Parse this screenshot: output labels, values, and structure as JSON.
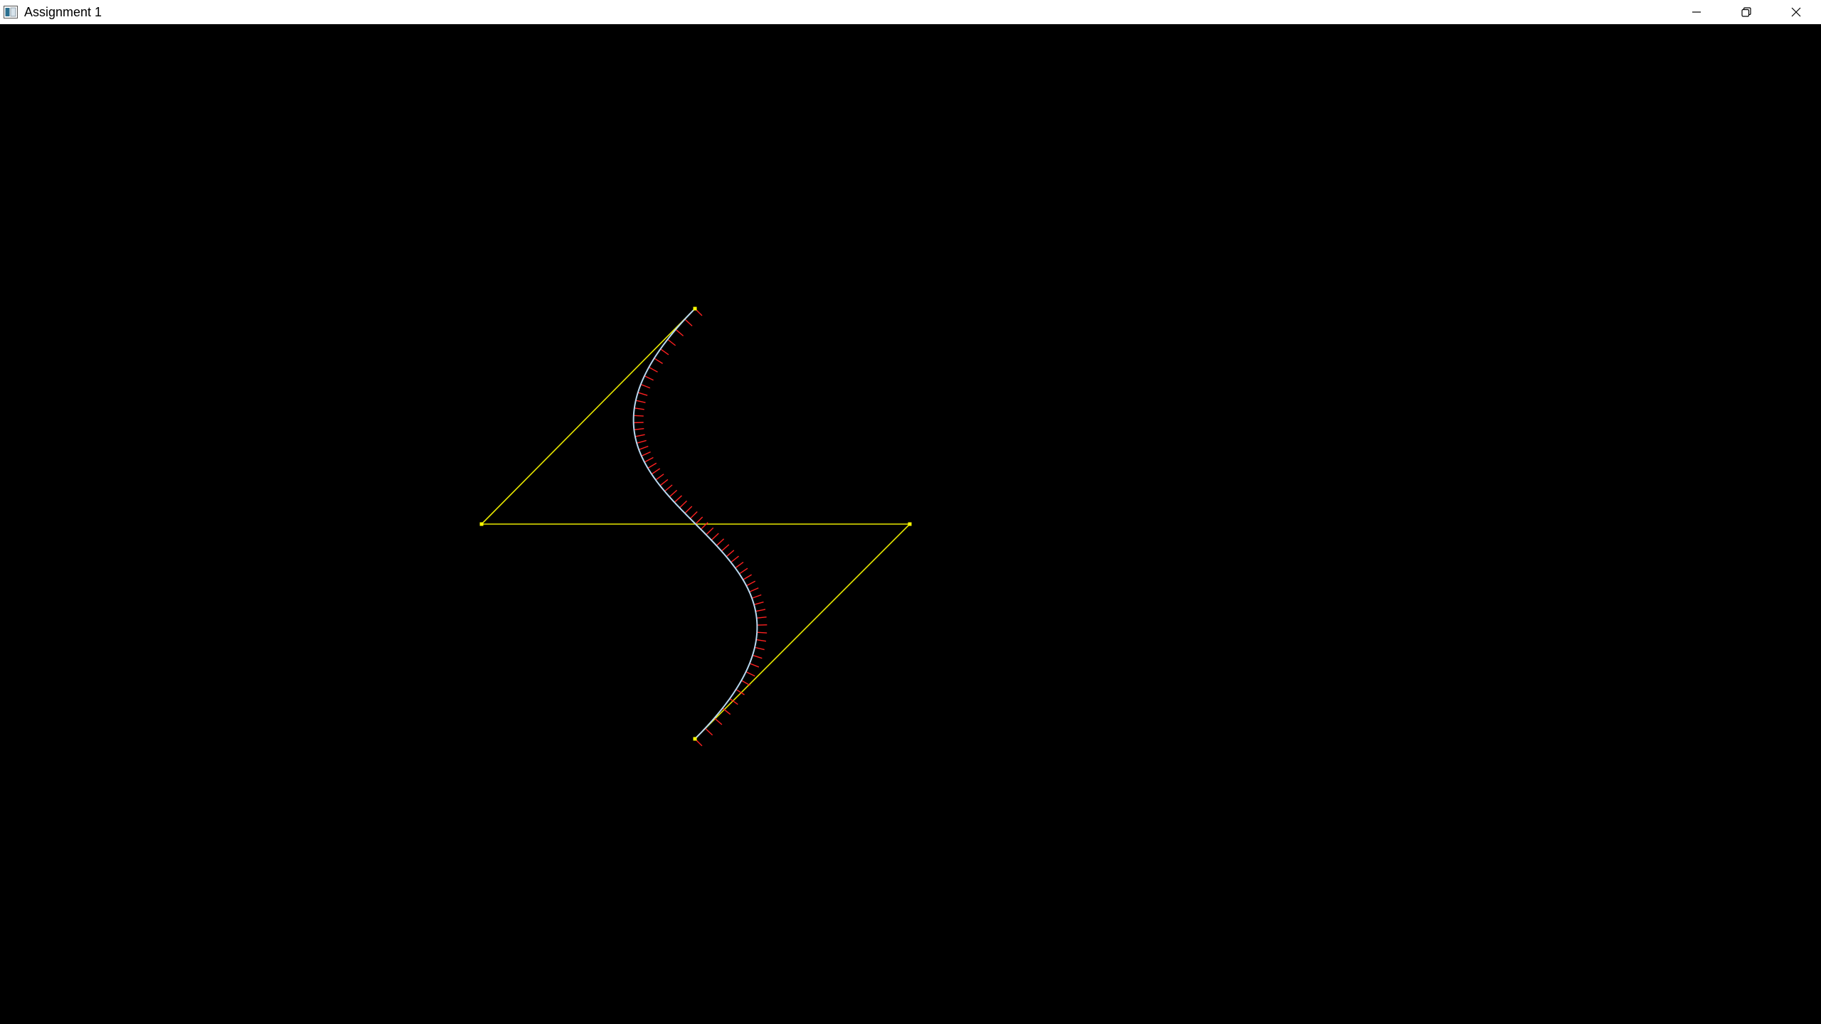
{
  "window": {
    "title": "Assignment 1",
    "app_icon": "window-app-icon",
    "buttons": {
      "minimize": "minimize-icon",
      "restore": "restore-icon",
      "close": "close-icon"
    }
  },
  "scene": {
    "background_color": "#000000",
    "control_polygon_color": "#e8e800",
    "control_point_color": "#ffff00",
    "curve_color": "#b8d8f0",
    "normal_color": "#ff2020",
    "curve_type": "cubic-bezier",
    "normal_count": 60
  }
}
